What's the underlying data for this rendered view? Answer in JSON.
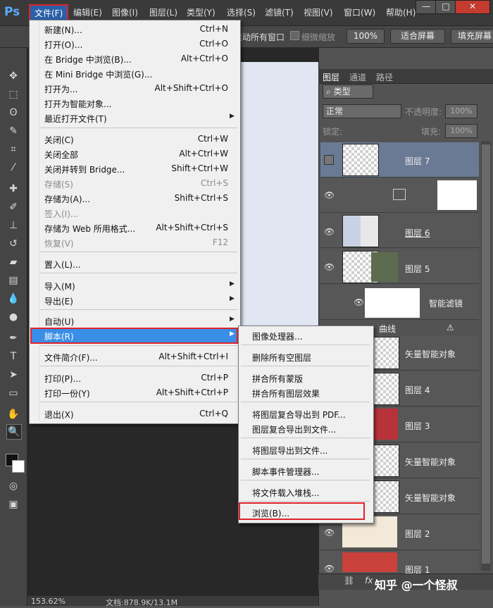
{
  "app": {
    "logo": "Ps"
  },
  "menubar": {
    "items": [
      "文件(F)",
      "编辑(E)",
      "图像(I)",
      "图层(L)",
      "类型(Y)",
      "选择(S)",
      "滤镜(T)",
      "视图(V)",
      "窗口(W)",
      "帮助(H)"
    ],
    "window_buttons": [
      "—",
      "□",
      "✕"
    ]
  },
  "options_bar": {
    "all_windows": "滚动所有窗口",
    "scrubby": "细微缩放",
    "zoom": "100%",
    "fit_screen": "适合屏幕",
    "fill_screen": "填充屏幕"
  },
  "file_menu": {
    "items": [
      {
        "label": "新建(N)...",
        "shortcut": "Ctrl+N",
        "enabled": true
      },
      {
        "label": "打开(O)...",
        "shortcut": "Ctrl+O",
        "enabled": true
      },
      {
        "label": "在 Bridge 中浏览(B)...",
        "shortcut": "Alt+Ctrl+O",
        "enabled": true
      },
      {
        "label": "在 Mini Bridge 中浏览(G)...",
        "shortcut": "",
        "enabled": true
      },
      {
        "label": "打开为...",
        "shortcut": "Alt+Shift+Ctrl+O",
        "enabled": true
      },
      {
        "label": "打开为智能对象...",
        "shortcut": "",
        "enabled": true
      },
      {
        "label": "最近打开文件(T)",
        "shortcut": "",
        "enabled": true
      },
      {
        "label": "关闭(C)",
        "shortcut": "Ctrl+W",
        "enabled": true
      },
      {
        "label": "关闭全部",
        "shortcut": "Alt+Ctrl+W",
        "enabled": true
      },
      {
        "label": "关闭并转到 Bridge...",
        "shortcut": "Shift+Ctrl+W",
        "enabled": true
      },
      {
        "label": "存储(S)",
        "shortcut": "Ctrl+S",
        "enabled": false
      },
      {
        "label": "存储为(A)...",
        "shortcut": "Shift+Ctrl+S",
        "enabled": true
      },
      {
        "label": "签入(I)...",
        "shortcut": "",
        "enabled": false
      },
      {
        "label": "存储为 Web 所用格式...",
        "shortcut": "Alt+Shift+Ctrl+S",
        "enabled": true
      },
      {
        "label": "恢复(V)",
        "shortcut": "F12",
        "enabled": false
      },
      {
        "label": "置入(L)...",
        "shortcut": "",
        "enabled": true
      },
      {
        "label": "导入(M)",
        "shortcut": "",
        "enabled": true
      },
      {
        "label": "导出(E)",
        "shortcut": "",
        "enabled": true
      },
      {
        "label": "自动(U)",
        "shortcut": "",
        "enabled": true
      },
      {
        "label": "脚本(R)",
        "shortcut": "",
        "enabled": true,
        "highlighted": true
      },
      {
        "label": "文件简介(F)...",
        "shortcut": "Alt+Shift+Ctrl+I",
        "enabled": true
      },
      {
        "label": "打印(P)...",
        "shortcut": "Ctrl+P",
        "enabled": true
      },
      {
        "label": "打印一份(Y)",
        "shortcut": "Alt+Shift+Ctrl+P",
        "enabled": true
      },
      {
        "label": "退出(X)",
        "shortcut": "Ctrl+Q",
        "enabled": true
      }
    ]
  },
  "scripts_submenu": {
    "items": [
      "图像处理器...",
      "删除所有空图层",
      "拼合所有蒙版",
      "拼合所有图层效果",
      "将图层复合导出到 PDF...",
      "图层复合导出到文件...",
      "将图层导出到文件...",
      "脚本事件管理器...",
      "将文件载入堆栈...",
      "浏览(B)..."
    ],
    "highlighted": "浏览(B)..."
  },
  "layers_panel": {
    "tabs": [
      "图层",
      "通道",
      "路径"
    ],
    "filter_kind": "类型",
    "blend_mode": "正常",
    "opacity_label": "不透明度:",
    "opacity_value": "100%",
    "lock_label": "锁定:",
    "fill_label": "填充:",
    "fill_value": "100%",
    "layers": [
      {
        "name": "图层 7",
        "selected": true,
        "visible": false
      },
      {
        "name": "",
        "visible": true
      },
      {
        "name": "图层 6",
        "visible": true
      },
      {
        "name": "图层 5",
        "visible": true
      },
      {
        "name": "智能滤镜",
        "visible": true
      },
      {
        "name": "曲线",
        "visible": true
      },
      {
        "name": "矢量智能对象",
        "visible": true
      },
      {
        "name": "图层 4",
        "visible": true
      },
      {
        "name": "图层 3",
        "visible": true
      },
      {
        "name": "矢量智能对象",
        "visible": true
      },
      {
        "name": "矢量智能对象",
        "visible": true
      },
      {
        "name": "图层 2",
        "visible": true
      },
      {
        "name": "图层 1",
        "visible": true
      }
    ],
    "watermark": "知乎 @一个怪叔"
  },
  "status": {
    "zoom": "153.62%",
    "doc": "文档:878.9K/13.1M"
  }
}
